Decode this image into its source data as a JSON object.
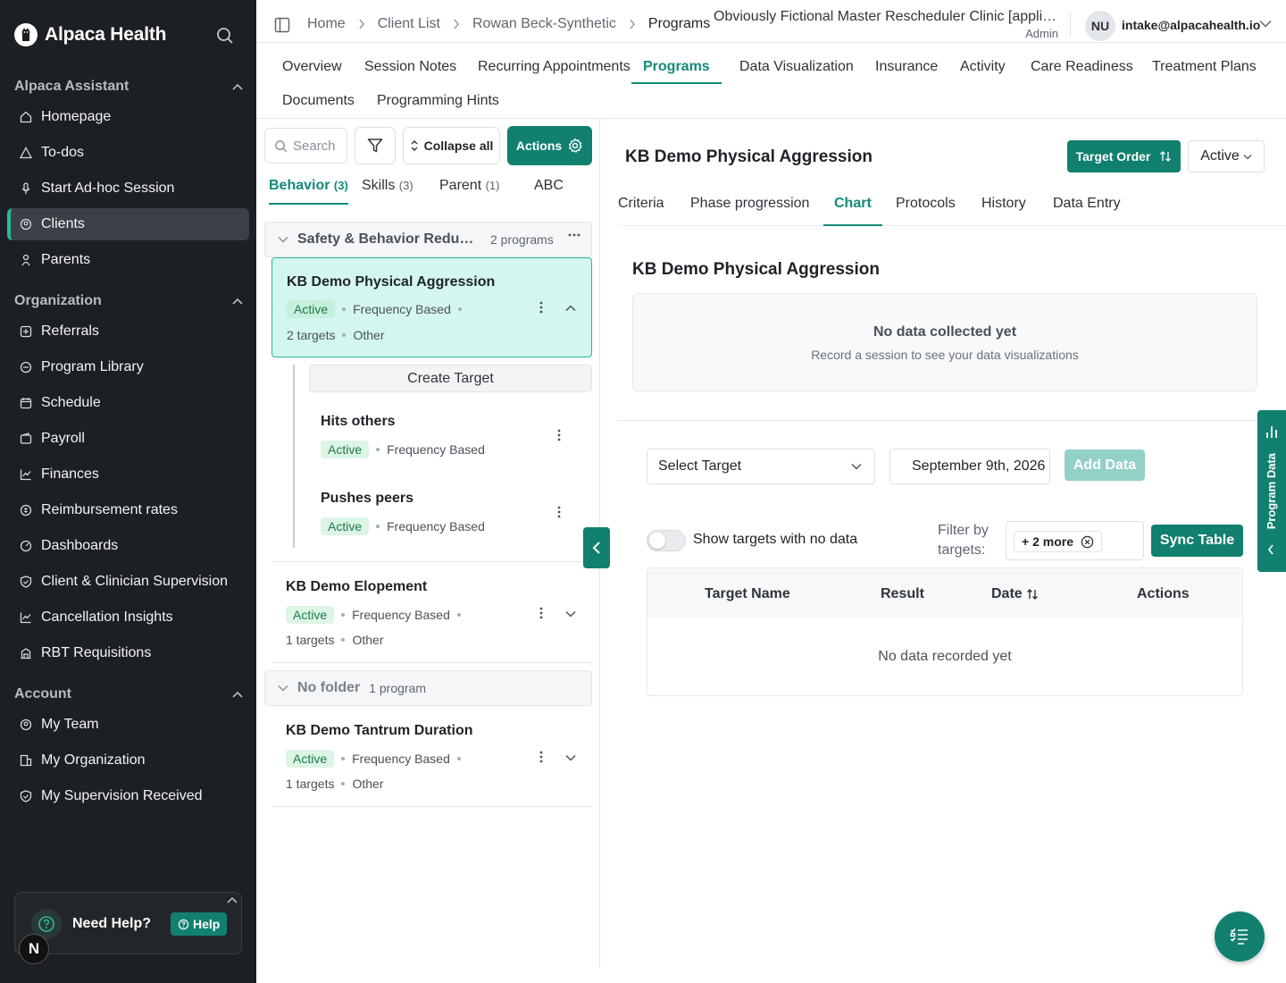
{
  "app": {
    "name": "Alpaca Health"
  },
  "sidebar": {
    "sections": [
      {
        "title": "Alpaca Assistant",
        "items": [
          "Homepage",
          "To-dos",
          "Start Ad-hoc Session",
          "Clients",
          "Parents"
        ]
      },
      {
        "title": "Organization",
        "items": [
          "Referrals",
          "Program Library",
          "Schedule",
          "Payroll",
          "Finances",
          "Reimbursement rates",
          "Dashboards",
          "Client & Clinician Supervision",
          "Cancellation Insights",
          "RBT Requisitions"
        ]
      },
      {
        "title": "Account",
        "items": [
          "My Team",
          "My Organization",
          "My Supervision Received"
        ]
      }
    ],
    "active_item": "Clients",
    "help": {
      "text": "Need Help?",
      "button": "Help"
    },
    "badge": "N"
  },
  "topbar": {
    "breadcrumbs": [
      "Home",
      "Client List",
      "Rowan Beck-Synthetic",
      "Programs"
    ],
    "clinic_name": "Obviously Fictional Master Rescheduler Clinic [application]",
    "role": "Admin",
    "avatar_initials": "NU",
    "email": "intake@alpacahealth.io"
  },
  "main_tabs": [
    "Overview",
    "Session Notes",
    "Recurring Appointments",
    "Programs",
    "Data Visualization",
    "Insurance",
    "Activity",
    "Care Readiness",
    "Treatment Plans",
    "Documents",
    "Programming Hints"
  ],
  "main_tabs_active": "Programs",
  "programs_pane": {
    "search_placeholder": "Search",
    "collapse_label": "Collapse all",
    "actions_label": "Actions",
    "tabs": [
      {
        "label": "Behavior",
        "count": "(3)"
      },
      {
        "label": "Skills",
        "count": "(3)"
      },
      {
        "label": "Parent",
        "count": "(1)"
      },
      {
        "label": "ABC",
        "count": ""
      }
    ],
    "folders": [
      {
        "name": "Safety & Behavior Reduction",
        "count": "2 programs"
      },
      {
        "name": "No folder",
        "count": "1 program"
      }
    ],
    "programs": [
      {
        "name": "KB Demo Physical Aggression",
        "status": "Active",
        "type": "Frequency Based",
        "targets": "2 targets",
        "category": "Other"
      },
      {
        "name": "KB Demo Elopement",
        "status": "Active",
        "type": "Frequency Based",
        "targets": "1 targets",
        "category": "Other"
      },
      {
        "name": "KB Demo Tantrum Duration",
        "status": "Active",
        "type": "Frequency Based",
        "targets": "1 targets",
        "category": "Other"
      }
    ],
    "create_target": "Create Target",
    "targets": [
      {
        "name": "Hits others",
        "status": "Active",
        "type": "Frequency Based"
      },
      {
        "name": "Pushes peers",
        "status": "Active",
        "type": "Frequency Based"
      }
    ]
  },
  "detail": {
    "title": "KB Demo Physical Aggression",
    "target_order": "Target Order",
    "status_select": "Active",
    "tabs": [
      "Criteria",
      "Phase progression",
      "Chart",
      "Protocols",
      "History",
      "Data Entry"
    ],
    "active_tab": "Chart",
    "chart_title": "KB Demo Physical Aggression",
    "empty_title": "No data collected yet",
    "empty_sub": "Record a session to see your data visualizations",
    "select_target": "Select Target",
    "date": "September 9th, 2026",
    "add_data": "Add Data",
    "toggle_label": "Show targets with no data",
    "filter_label": "Filter by targets:",
    "filter_chip": "+ 2 more",
    "sync_table": "Sync Table",
    "table_headers": [
      "Target Name",
      "Result",
      "Date",
      "Actions"
    ],
    "table_empty": "No data recorded yet"
  },
  "program_data_tab": "Program Data",
  "colors": {
    "brand": "#12806f",
    "sidebar_bg": "#1c1f23",
    "selected_bg": "#d3f6ef"
  }
}
